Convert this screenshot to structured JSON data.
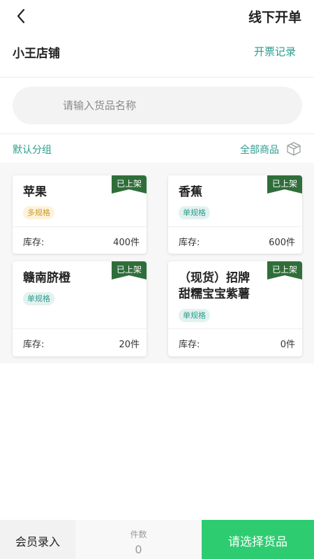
{
  "header": {
    "title": "线下开单",
    "back_icon": "chevron-left-icon"
  },
  "store": {
    "name": "小王店铺",
    "invoice_link": "开票记录"
  },
  "search": {
    "placeholder": "请输入货品名称",
    "value": ""
  },
  "category": {
    "default_label": "默认分组",
    "all_label": "全部商品",
    "all_icon": "box-icon"
  },
  "colors": {
    "accent": "#2a9d8f",
    "primary_button": "#2ecc71",
    "ribbon": "#2f6e3a"
  },
  "products": [
    {
      "name": "苹果",
      "spec": "多规格",
      "spec_type": "multi",
      "stock_label": "库存:",
      "stock": "400件",
      "status": "已上架"
    },
    {
      "name": "香蕉",
      "spec": "单规格",
      "spec_type": "single",
      "stock_label": "库存:",
      "stock": "600件",
      "status": "已上架"
    },
    {
      "name": "赣南脐橙",
      "spec": "单规格",
      "spec_type": "single",
      "stock_label": "库存:",
      "stock": "20件",
      "status": "已上架"
    },
    {
      "name_line1": "（现货）招牌",
      "name_line2": "甜糯宝宝紫薯",
      "spec": "单规格",
      "spec_type": "single",
      "stock_label": "库存:",
      "stock": "0件",
      "status": "已上架"
    }
  ],
  "footer": {
    "member_button": "会员录入",
    "count_label": "件数",
    "count_value": "0",
    "select_button": "请选择货品"
  }
}
